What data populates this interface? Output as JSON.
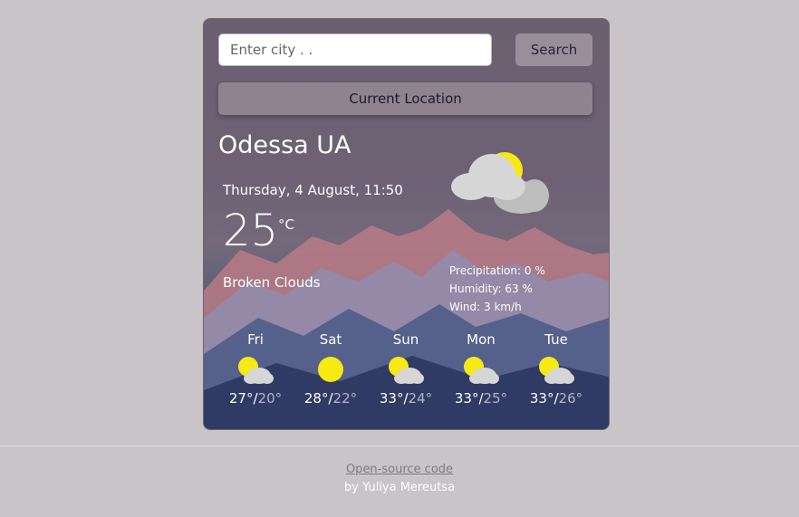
{
  "search": {
    "placeholder": "Enter city . .",
    "button_label": "Search"
  },
  "location_button_label": "Current Location",
  "current": {
    "city": "Odessa UA",
    "datetime": "Thursday, 4 August, 11:50",
    "temperature": "25",
    "unit": "°C",
    "description": "Broken Clouds",
    "icon": "broken-clouds-icon",
    "precipitation": "Precipitation: 0 %",
    "humidity": "Humidity: 63 %",
    "wind": "Wind: 3 km/h"
  },
  "forecast": [
    {
      "day": "Fri",
      "max": "27°",
      "min": "20°",
      "icon": "partly-cloudy-icon"
    },
    {
      "day": "Sat",
      "max": "28°",
      "min": "22°",
      "icon": "sun-icon"
    },
    {
      "day": "Sun",
      "max": "33°",
      "min": "24°",
      "icon": "partly-cloudy-icon"
    },
    {
      "day": "Mon",
      "max": "33°",
      "min": "25°",
      "icon": "partly-cloudy-icon"
    },
    {
      "day": "Tue",
      "max": "33°",
      "min": "26°",
      "icon": "partly-cloudy-icon"
    }
  ],
  "footer": {
    "link": "Open-source code",
    "by": "by Yuliya Mereutsa"
  },
  "colors": {
    "sun": "#f5ea12",
    "cloud": "#d6d6d6",
    "page_bg": "#c9c4c7"
  }
}
